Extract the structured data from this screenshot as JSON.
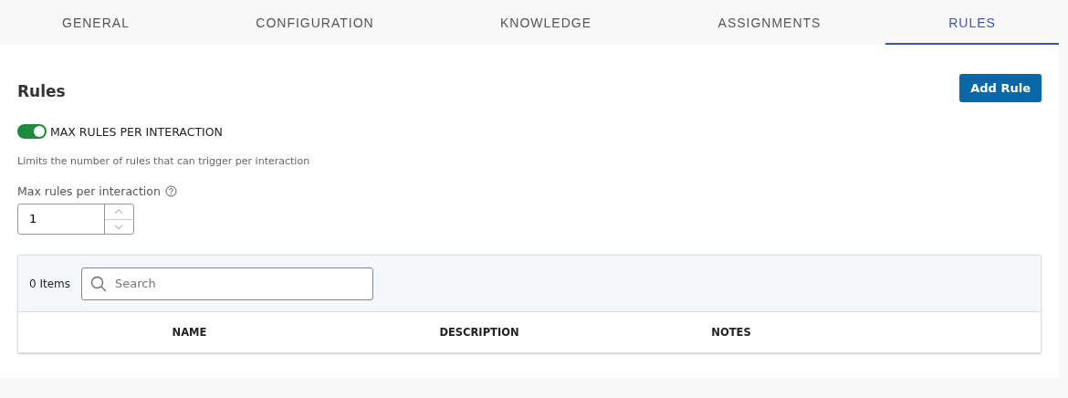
{
  "tabs": [
    {
      "label": "GENERAL",
      "selected": false
    },
    {
      "label": "CONFIGURATION",
      "selected": false
    },
    {
      "label": "KNOWLEDGE",
      "selected": false
    },
    {
      "label": "ASSIGNMENTS",
      "selected": false
    },
    {
      "label": "RULES",
      "selected": true
    }
  ],
  "heading": "Rules",
  "add_button": "Add Rule",
  "toggle": {
    "label": "MAX RULES PER INTERACTION",
    "on": true
  },
  "description": "Limits the number of rules that can trigger per interaction",
  "number_field": {
    "label": "Max rules per interaction",
    "value": "1"
  },
  "table": {
    "count": "0 Items",
    "search": {
      "placeholder": "Search"
    },
    "columns": [
      "NAME",
      "DESCRIPTION",
      "NOTES"
    ]
  }
}
